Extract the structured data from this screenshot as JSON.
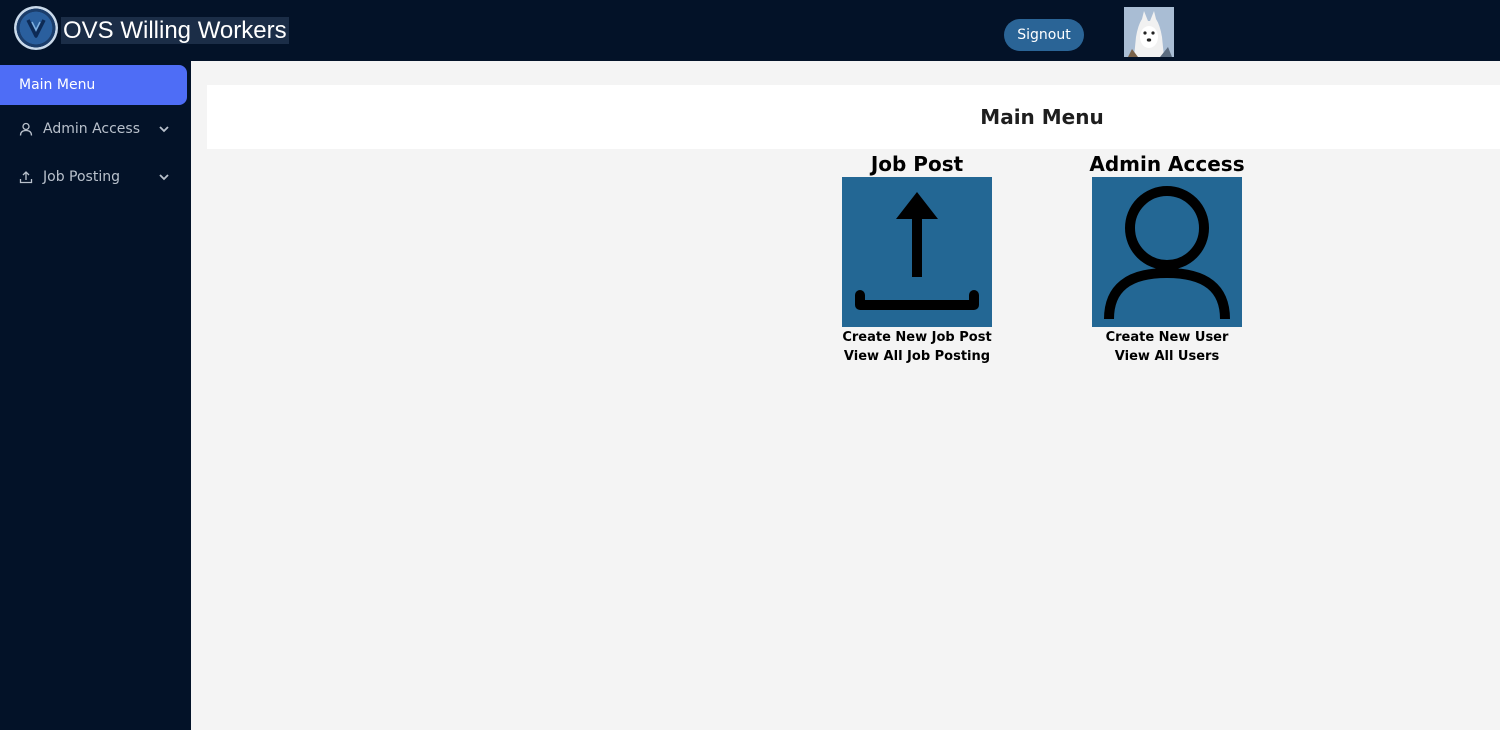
{
  "header": {
    "app_title": "OVS Willing Workers",
    "logo_icon": "ovs-logo",
    "signout_label": "Signout",
    "avatar_icon": "husky-avatar",
    "accent_color": "#2a6496"
  },
  "sidebar": {
    "items": [
      {
        "label": "Main Menu",
        "active": true
      },
      {
        "label": "Admin Access",
        "icon": "user-icon",
        "expandable": true
      },
      {
        "label": "Job Posting",
        "icon": "upload-icon",
        "expandable": true
      }
    ],
    "active_color": "#4e6df6"
  },
  "main": {
    "title": "Main Menu",
    "tiles": [
      {
        "title": "Job Post",
        "icon": "upload-icon",
        "links": [
          "Create New Job Post",
          "View All Job Posting"
        ]
      },
      {
        "title": "Admin Access",
        "icon": "user-icon",
        "links": [
          "Create New User",
          "View All Users"
        ]
      }
    ],
    "tile_color": "#236794"
  }
}
